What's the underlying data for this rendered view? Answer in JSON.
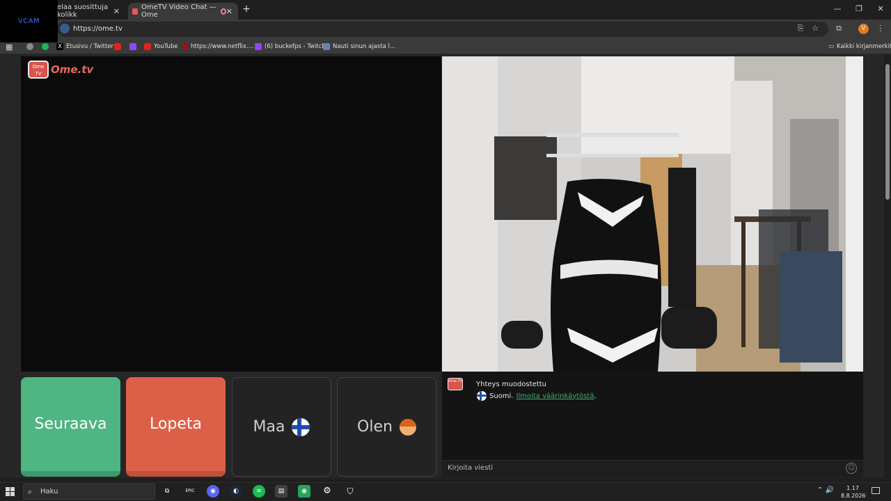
{
  "overlay": {
    "vcam_label": "VCAM"
  },
  "browser": {
    "tabs": [
      {
        "label": "elaa suosittuja kolikk",
        "active": false
      },
      {
        "label": "OmeTV Video Chat — Ome",
        "active": true
      }
    ],
    "new_tab": "+",
    "window_controls": {
      "minimize": "—",
      "restore": "❐",
      "close": "✕"
    },
    "url": "https://ome.tv",
    "profile_initial": "V",
    "bookmarks": [
      {
        "label": "",
        "icon": "link-icon",
        "color": "#8a8a8a"
      },
      {
        "label": "",
        "icon": "spotify-icon",
        "color": "#1db954"
      },
      {
        "label": "Etusivu / Twitter",
        "icon": "x-icon",
        "color": "#000000"
      },
      {
        "label": "",
        "icon": "youtube-icon",
        "color": "#e62117"
      },
      {
        "label": "",
        "icon": "twitch-icon",
        "color": "#9146ff"
      },
      {
        "label": "YouTube",
        "icon": "youtube-icon",
        "color": "#e62117"
      },
      {
        "label": "https://www.netflix....",
        "icon": "netflix-icon",
        "color": "#b20710"
      },
      {
        "label": "(6) buckefps - Twitch",
        "icon": "twitch-icon",
        "color": "#9146ff"
      },
      {
        "label": "Nauti sinun ajasta l...",
        "icon": "site-icon",
        "color": "#6a7fb5"
      }
    ],
    "all_bookmarks": "Kaikki kirjanmerkit"
  },
  "ometv": {
    "logo_text": "Ome.tv",
    "logo_badge": "Ome TV",
    "buttons": {
      "next": "Seuraava",
      "stop": "Lopeta",
      "country": "Maa",
      "gender": "Olen"
    },
    "chat": {
      "status": "Yhteys muodostettu",
      "country_name": "Suomi.",
      "report_link": "Ilmoita väärinkäytöstä",
      "report_suffix": ".",
      "input_placeholder": "Kirjoita viesti"
    }
  },
  "taskbar": {
    "search_placeholder": "Haku",
    "apps": [
      {
        "icon": "task-view-icon",
        "color": "#202020",
        "glyph": "⧉"
      },
      {
        "icon": "epic-games-icon",
        "color": "#202020",
        "glyph": "EPIC"
      },
      {
        "icon": "discord-icon",
        "color": "#5865f2",
        "glyph": "◉"
      },
      {
        "icon": "steam-icon",
        "color": "#1b2838",
        "glyph": "◐"
      },
      {
        "icon": "spotify-icon",
        "color": "#1db954",
        "glyph": "≋"
      },
      {
        "icon": "file-icon",
        "color": "#404040",
        "glyph": "▤"
      },
      {
        "icon": "discord-icon",
        "color": "#23a55a",
        "glyph": "◉"
      },
      {
        "icon": "settings-icon",
        "color": "#202020",
        "glyph": "⚙"
      },
      {
        "icon": "shield-icon",
        "color": "#202020",
        "glyph": "⛉"
      }
    ],
    "tray": "⌃  🔊",
    "time": "1.17",
    "date": "8.8.2026"
  },
  "colors": {
    "next": "#4fb583",
    "stop": "#dc6048",
    "link": "#3fae72"
  }
}
